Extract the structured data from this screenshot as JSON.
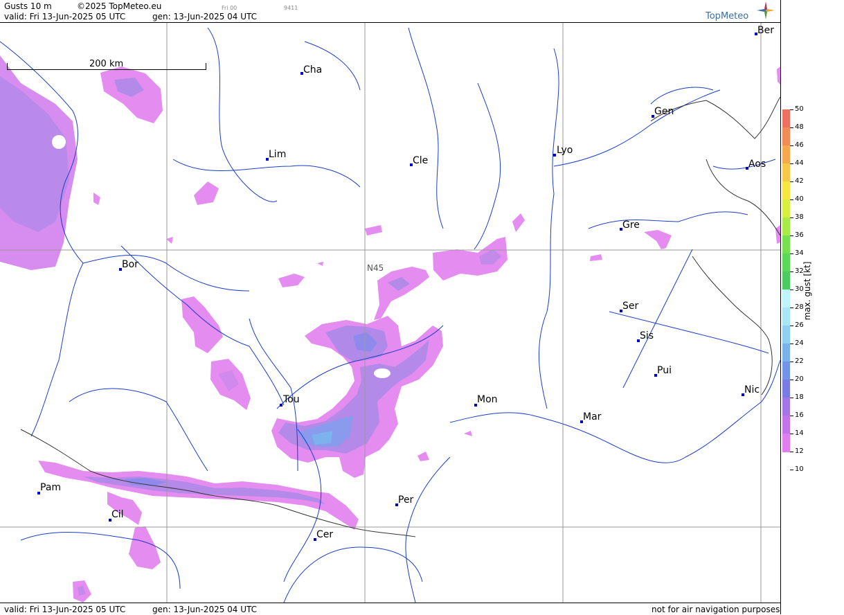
{
  "header": {
    "product": "Gusts 10 m",
    "copyright": "©2025 TopMeteo.eu",
    "run": "Fri 00",
    "code": "9411",
    "valid": "valid:  Fri  13-Jun-2025  05 UTC",
    "gen": "gen: 13-Jun-2025 04 UTC",
    "logo": "TopMeteo"
  },
  "footer": {
    "valid": "valid:  Fri  13-Jun-2025  05 UTC",
    "gen": "gen: 13-Jun-2025 04 UTC",
    "disclaimer": "not for air navigation purposes"
  },
  "map": {
    "scale_label": "200 km",
    "grid_label": "N45",
    "cities": [
      {
        "name": "Cha"
      },
      {
        "name": "Ber"
      },
      {
        "name": "Gen"
      },
      {
        "name": "Lim"
      },
      {
        "name": "Cle"
      },
      {
        "name": "Lyo"
      },
      {
        "name": "Aos"
      },
      {
        "name": "Gre"
      },
      {
        "name": "Bor"
      },
      {
        "name": "Ser"
      },
      {
        "name": "Sis"
      },
      {
        "name": "Pui"
      },
      {
        "name": "Tou"
      },
      {
        "name": "Mon"
      },
      {
        "name": "Nic"
      },
      {
        "name": "Mar"
      },
      {
        "name": "Pam"
      },
      {
        "name": "Per"
      },
      {
        "name": "Cil"
      },
      {
        "name": "Cer"
      }
    ],
    "colors": {
      "water": "#1a3cc8",
      "border": "#333333",
      "grid": "#999999",
      "city_dot": "#0000cc"
    }
  },
  "legend": {
    "axis_label": "max. gust  [kt]",
    "ticks": [
      "50",
      "48",
      "46",
      "44",
      "42",
      "40",
      "38",
      "36",
      "34",
      "32",
      "30",
      "28",
      "26",
      "24",
      "22",
      "20",
      "18",
      "16",
      "14",
      "12",
      "10"
    ],
    "colors": [
      "#f07060",
      "#f48a55",
      "#f6a84d",
      "#f8c848",
      "#f6e640",
      "#d8ee40",
      "#a8ea48",
      "#78e050",
      "#5cd858",
      "#4ccc60",
      "#bff4ff",
      "#a8e8f6",
      "#8ed0f2",
      "#7ab2ec",
      "#7394ea",
      "#7a7ce6",
      "#a276e6",
      "#c274ea",
      "#e07ef0"
    ]
  }
}
